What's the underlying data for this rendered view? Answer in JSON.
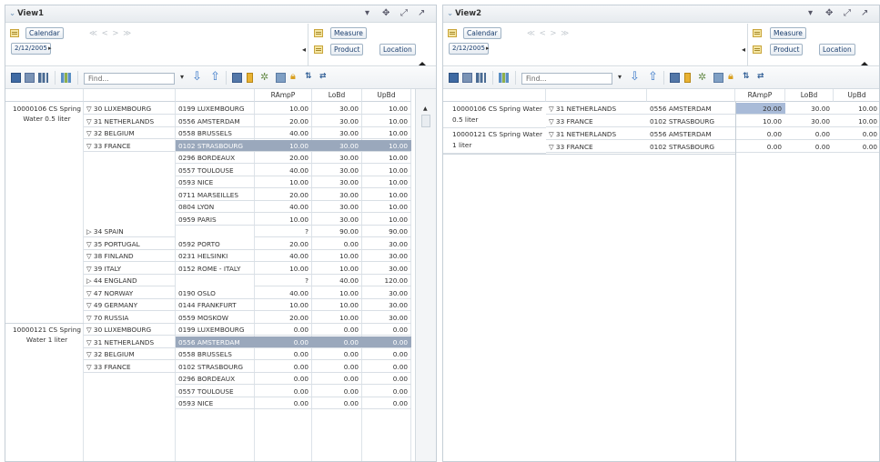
{
  "view1": {
    "title": "View1",
    "controls": [
      "▾",
      "✥",
      "⤢",
      "↗"
    ],
    "dims": {
      "calendar_label": "Calendar",
      "date_value": "2/12/2005",
      "nav": "≪ < > ≫",
      "measure_label": "Measure",
      "product_label": "Product",
      "location_label": "Location"
    },
    "find_placeholder": "Find...",
    "columns": [
      "RAmpP",
      "LoBd",
      "UpBd"
    ],
    "products": [
      "10000106 CS Spring Water 0.5 liter",
      "10000121 CS Spring Water 1 liter"
    ],
    "rows": [
      {
        "country": "▽ 30 LUXEMBOURG",
        "city": "0199 LUXEMBOURG",
        "v": [
          "10.00",
          "30.00",
          "10.00"
        ]
      },
      {
        "country": "▽ 31 NETHERLANDS",
        "city": "0556 AMSTERDAM",
        "v": [
          "20.00",
          "30.00",
          "10.00"
        ]
      },
      {
        "country": "▽ 32 BELGIUM",
        "city": "0558 BRUSSELS",
        "v": [
          "40.00",
          "30.00",
          "10.00"
        ]
      },
      {
        "country": "▽ 33 FRANCE",
        "city": "0102 STRASBOURG",
        "v": [
          "10.00",
          "30.00",
          "10.00"
        ]
      },
      {
        "country": "",
        "city": "0296 BORDEAUX",
        "v": [
          "20.00",
          "30.00",
          "10.00"
        ]
      },
      {
        "country": "",
        "city": "0557 TOULOUSE",
        "v": [
          "40.00",
          "30.00",
          "10.00"
        ]
      },
      {
        "country": "",
        "city": "0593 NICE",
        "v": [
          "10.00",
          "30.00",
          "10.00"
        ]
      },
      {
        "country": "",
        "city": "0711 MARSEILLES",
        "v": [
          "20.00",
          "30.00",
          "10.00"
        ]
      },
      {
        "country": "",
        "city": "0804 LYON",
        "v": [
          "40.00",
          "30.00",
          "10.00"
        ]
      },
      {
        "country": "",
        "city": "0959 PARIS",
        "v": [
          "10.00",
          "30.00",
          "10.00"
        ]
      },
      {
        "country": "▷ 34 SPAIN",
        "city": "",
        "v": [
          "?",
          "90.00",
          "90.00"
        ]
      },
      {
        "country": "▽ 35 PORTUGAL",
        "city": "0592 PORTO",
        "v": [
          "20.00",
          "0.00",
          "30.00"
        ]
      },
      {
        "country": "▽ 38 FINLAND",
        "city": "0231 HELSINKI",
        "v": [
          "40.00",
          "10.00",
          "30.00"
        ]
      },
      {
        "country": "▽ 39 ITALY",
        "city": "0152 ROME - ITALY",
        "v": [
          "10.00",
          "10.00",
          "30.00"
        ]
      },
      {
        "country": "▷ 44 ENGLAND",
        "city": "",
        "v": [
          "?",
          "40.00",
          "120.00"
        ]
      },
      {
        "country": "▽ 47 NORWAY",
        "city": "0190 OSLO",
        "v": [
          "40.00",
          "10.00",
          "30.00"
        ]
      },
      {
        "country": "▽ 49 GERMANY",
        "city": "0144 FRANKFURT",
        "v": [
          "10.00",
          "10.00",
          "30.00"
        ]
      },
      {
        "country": "▽ 70 RUSSIA",
        "city": "0559 MOSKOW",
        "v": [
          "20.00",
          "10.00",
          "30.00"
        ]
      },
      {
        "country": "▽ 30 LUXEMBOURG",
        "city": "0199 LUXEMBOURG",
        "v": [
          "0.00",
          "0.00",
          "0.00"
        ]
      },
      {
        "country": "▽ 31 NETHERLANDS",
        "city": "0556 AMSTERDAM",
        "v": [
          "0.00",
          "0.00",
          "0.00"
        ]
      },
      {
        "country": "▽ 32 BELGIUM",
        "city": "0558 BRUSSELS",
        "v": [
          "0.00",
          "0.00",
          "0.00"
        ]
      },
      {
        "country": "▽ 33 FRANCE",
        "city": "0102 STRASBOURG",
        "v": [
          "0.00",
          "0.00",
          "0.00"
        ]
      },
      {
        "country": "",
        "city": "0296 BORDEAUX",
        "v": [
          "0.00",
          "0.00",
          "0.00"
        ]
      },
      {
        "country": "",
        "city": "0557 TOULOUSE",
        "v": [
          "0.00",
          "0.00",
          "0.00"
        ]
      },
      {
        "country": "",
        "city": "0593 NICE",
        "v": [
          "0.00",
          "0.00",
          "0.00"
        ]
      }
    ]
  },
  "view2": {
    "title": "View2",
    "controls": [
      "▾",
      "✥",
      "⤢",
      "↗"
    ],
    "dims": {
      "calendar_label": "Calendar",
      "date_value": "2/12/2005",
      "nav": "≪ < > ≫",
      "measure_label": "Measure",
      "product_label": "Product",
      "location_label": "Location"
    },
    "find_placeholder": "Find...",
    "columns": [
      "RAmpP",
      "LoBd",
      "UpBd"
    ],
    "products": [
      "10000106 CS Spring Water 0.5 liter",
      "10000121 CS Spring Water 1 liter"
    ],
    "rows": [
      {
        "country": "▽ 31 NETHERLANDS",
        "city": "0556 AMSTERDAM",
        "v": [
          "20.00",
          "30.00",
          "10.00"
        ]
      },
      {
        "country": "▽ 33 FRANCE",
        "city": "0102 STRASBOURG",
        "v": [
          "10.00",
          "30.00",
          "10.00"
        ]
      },
      {
        "country": "▽ 31 NETHERLANDS",
        "city": "0556 AMSTERDAM",
        "v": [
          "0.00",
          "0.00",
          "0.00"
        ]
      },
      {
        "country": "▽ 33 FRANCE",
        "city": "0102 STRASBOURG",
        "v": [
          "0.00",
          "0.00",
          "0.00"
        ]
      }
    ]
  },
  "colors": {
    "highlight": "#9aa8bc",
    "accent": "#1b3e6e"
  }
}
